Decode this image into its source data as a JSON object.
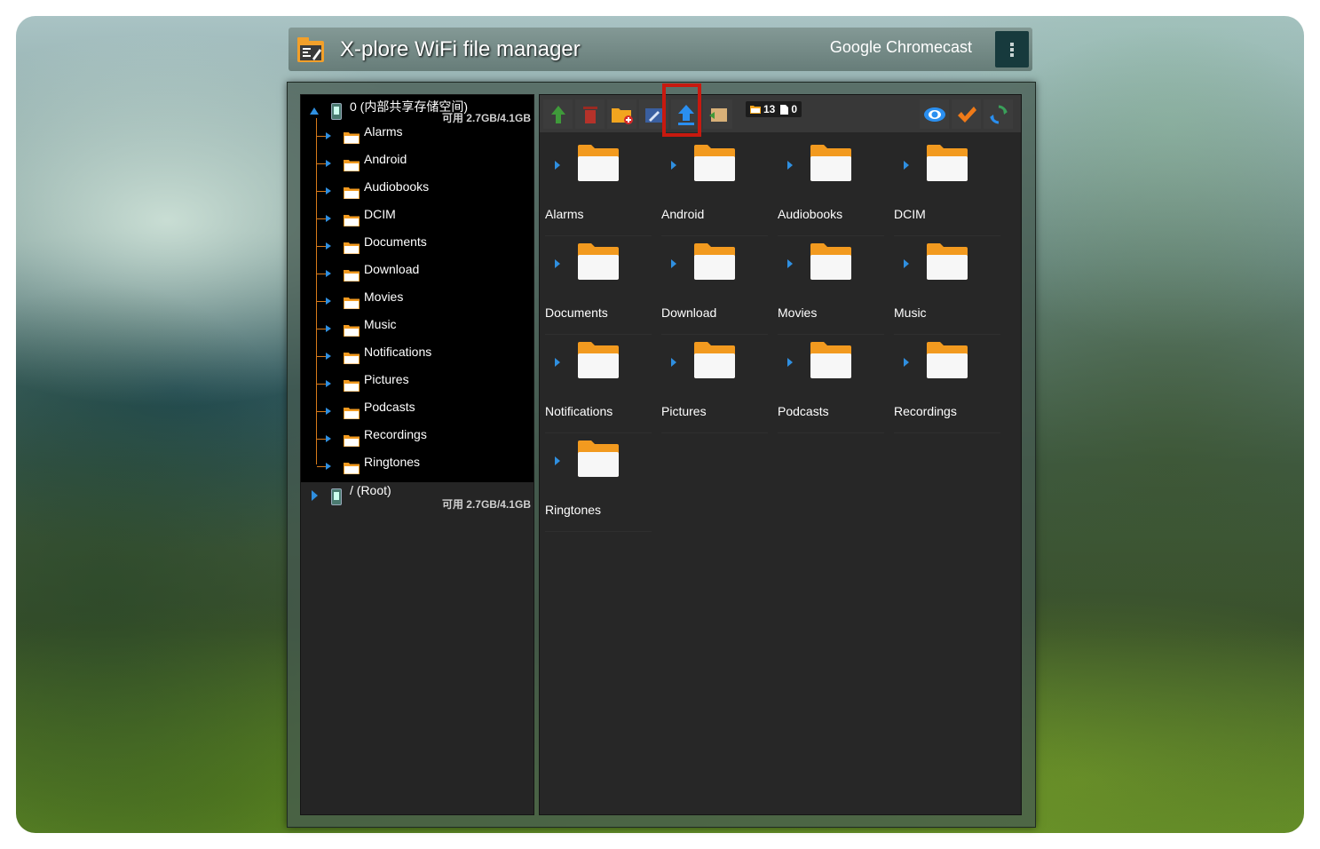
{
  "app": {
    "title": "X-plore WiFi file manager",
    "device": "Google Chromecast"
  },
  "tree": {
    "storage_label": "0 (内部共享存储空间)",
    "storage_free": "可用 2.7GB/4.1GB",
    "items": [
      "Alarms",
      "Android",
      "Audiobooks",
      "DCIM",
      "Documents",
      "Download",
      "Movies",
      "Music",
      "Notifications",
      "Pictures",
      "Podcasts",
      "Recordings",
      "Ringtones"
    ],
    "root_label": "/ (Root)",
    "root_free": "可用 2.7GB/4.1GB"
  },
  "toolbar": {
    "folder_count": "13",
    "file_count": "0",
    "buttons": [
      "up-icon",
      "delete-icon",
      "new-folder-icon",
      "rename-icon",
      "upload-icon",
      "move-icon",
      "eye-icon",
      "checkmark-icon",
      "refresh-icon"
    ],
    "highlighted": "upload-icon"
  },
  "grid": {
    "items": [
      "Alarms",
      "Android",
      "Audiobooks",
      "DCIM",
      "Documents",
      "Download",
      "Movies",
      "Music",
      "Notifications",
      "Pictures",
      "Podcasts",
      "Recordings",
      "Ringtones"
    ]
  },
  "colors": {
    "highlight": "#c8190f",
    "folder": "#f29a1f",
    "tree_line": "#d87a1a",
    "arrow": "#2f8fe0"
  }
}
